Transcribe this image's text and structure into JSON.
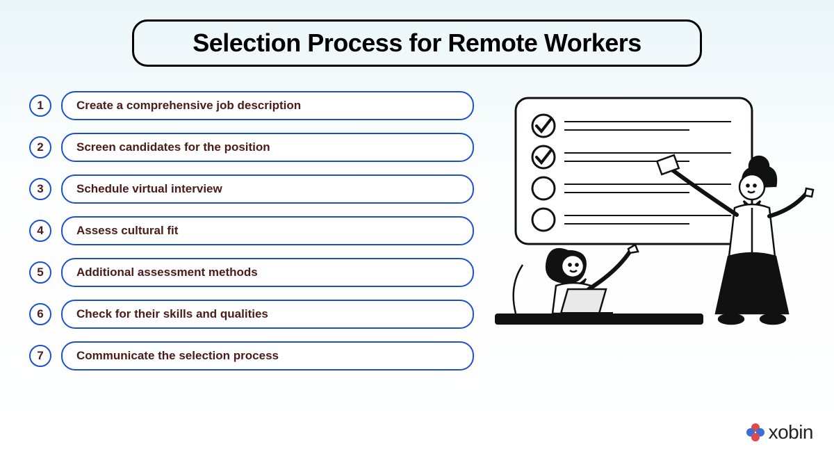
{
  "title": "Selection Process for Remote Workers",
  "steps": [
    {
      "n": "1",
      "label": "Create a comprehensive job description"
    },
    {
      "n": "2",
      "label": "Screen candidates for the position"
    },
    {
      "n": "3",
      "label": "Schedule virtual interview"
    },
    {
      "n": "4",
      "label": "Assess cultural fit"
    },
    {
      "n": "5",
      "label": "Additional assessment methods"
    },
    {
      "n": "6",
      "label": "Check for their skills and qualities"
    },
    {
      "n": "7",
      "label": "Communicate the selection process"
    }
  ],
  "brand": {
    "name": "xobin"
  },
  "colors": {
    "outline_blue": "#1a4fd6",
    "text_dark": "#4b1b1b",
    "logo_red": "#e04a4a",
    "logo_blue": "#3a6fd8"
  }
}
